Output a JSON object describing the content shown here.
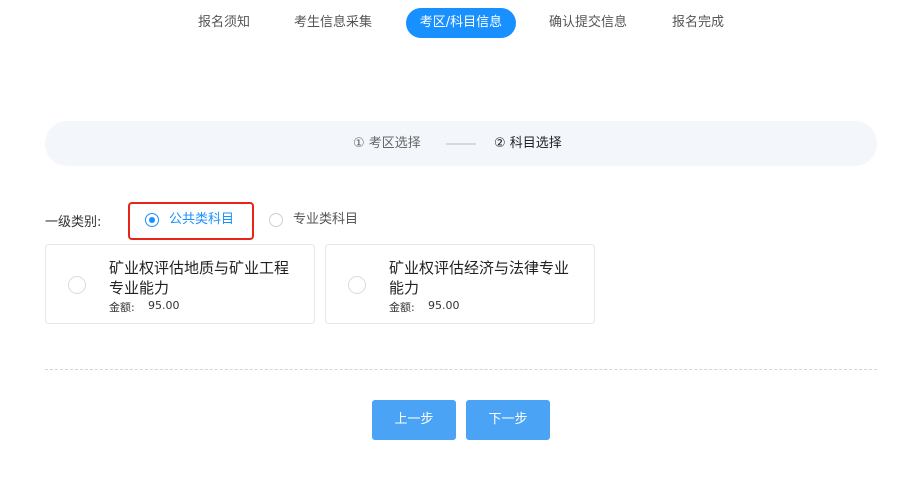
{
  "steps_nav": [
    {
      "label": "报名须知",
      "active": false
    },
    {
      "label": "考生信息采集",
      "active": false
    },
    {
      "label": "考区/科目信息",
      "active": true
    },
    {
      "label": "确认提交信息",
      "active": false
    },
    {
      "label": "报名完成",
      "active": false
    }
  ],
  "sub_steps": {
    "step1": "① 考区选择",
    "step2": "② 科目选择"
  },
  "category": {
    "label": "一级类别:",
    "options": [
      {
        "label": "公共类科目",
        "checked": true
      },
      {
        "label": "专业类科目",
        "checked": false
      }
    ]
  },
  "subjects": [
    {
      "name": "矿业权评估地质与矿业工程专业能力",
      "fee_label": "金额:",
      "fee_value": "95.00"
    },
    {
      "name": "矿业权评估经济与法律专业能力",
      "fee_label": "金额:",
      "fee_value": "95.00"
    }
  ],
  "buttons": {
    "prev": "上一步",
    "next": "下一步"
  },
  "colors": {
    "accent": "#1890ff",
    "button": "#4ba3f5",
    "highlight": "#e8231a",
    "sub_steps_bg": "#f3f7fc"
  }
}
